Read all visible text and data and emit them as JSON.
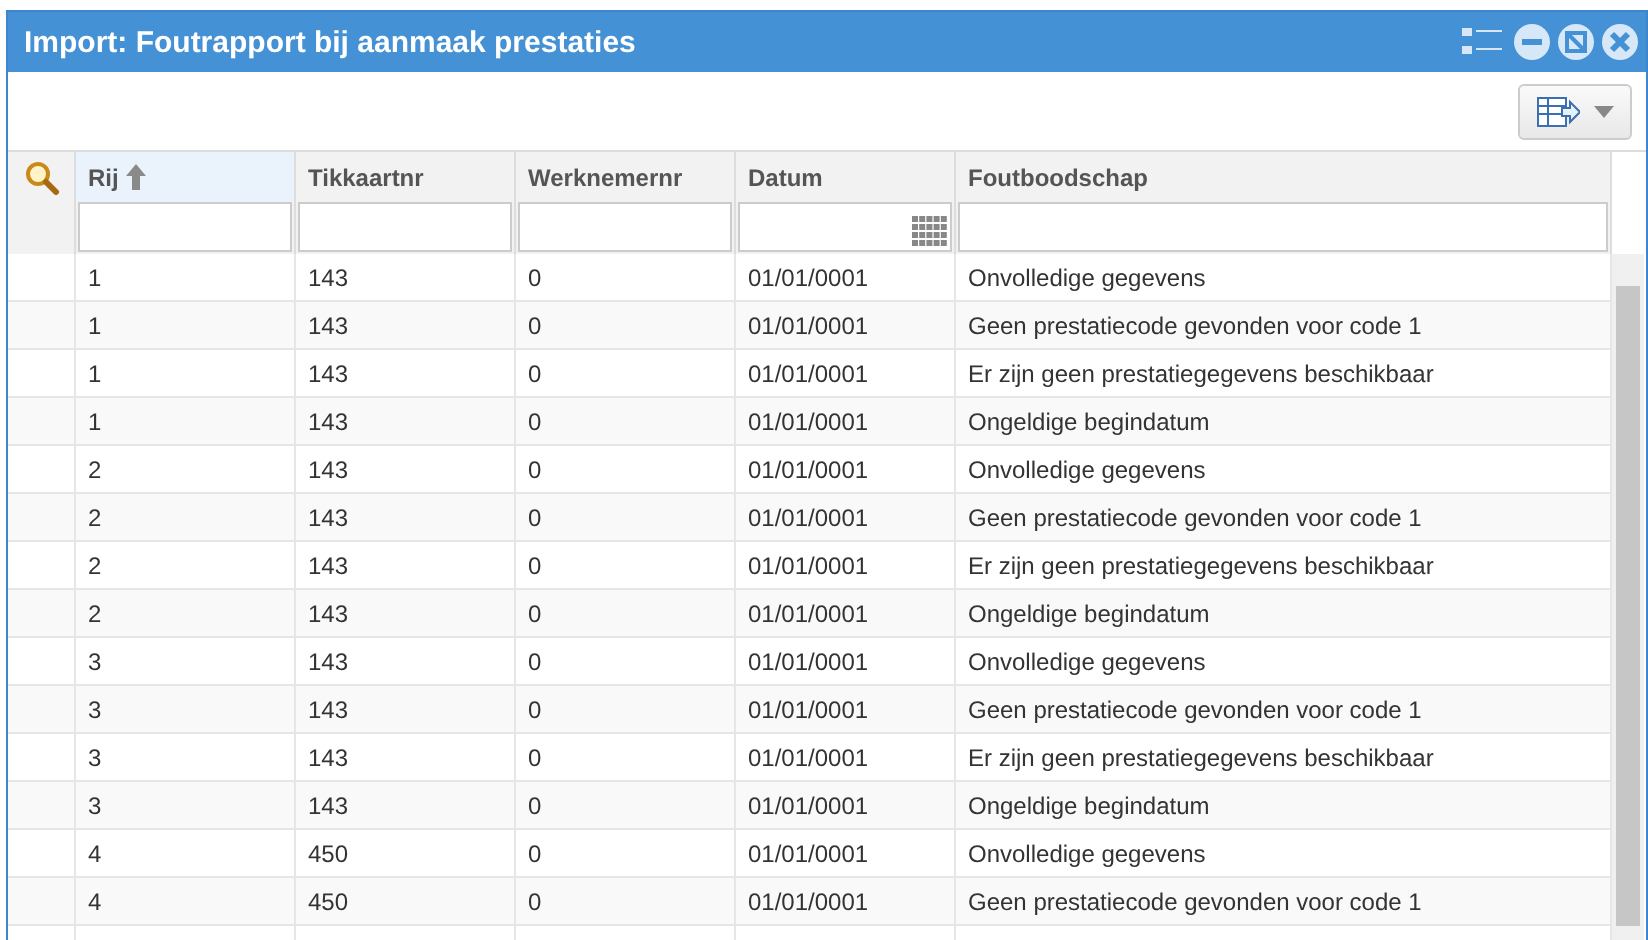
{
  "window": {
    "title": "Import: Foutrapport bij aanmaak prestaties"
  },
  "grid": {
    "columns": [
      {
        "label": "Rij",
        "sorted": true,
        "calendar": false
      },
      {
        "label": "Tikkaartnr",
        "sorted": false,
        "calendar": false
      },
      {
        "label": "Werknemernr",
        "sorted": false,
        "calendar": false
      },
      {
        "label": "Datum",
        "sorted": false,
        "calendar": true
      },
      {
        "label": "Foutboodschap",
        "sorted": false,
        "calendar": false
      }
    ],
    "rows": [
      [
        "1",
        "143",
        "0",
        "01/01/0001",
        "Onvolledige gegevens"
      ],
      [
        "1",
        "143",
        "0",
        "01/01/0001",
        "Geen prestatiecode gevonden voor code 1"
      ],
      [
        "1",
        "143",
        "0",
        "01/01/0001",
        "Er zijn geen prestatiegegevens beschikbaar"
      ],
      [
        "1",
        "143",
        "0",
        "01/01/0001",
        "Ongeldige begindatum"
      ],
      [
        "2",
        "143",
        "0",
        "01/01/0001",
        "Onvolledige gegevens"
      ],
      [
        "2",
        "143",
        "0",
        "01/01/0001",
        "Geen prestatiecode gevonden voor code 1"
      ],
      [
        "2",
        "143",
        "0",
        "01/01/0001",
        "Er zijn geen prestatiegegevens beschikbaar"
      ],
      [
        "2",
        "143",
        "0",
        "01/01/0001",
        "Ongeldige begindatum"
      ],
      [
        "3",
        "143",
        "0",
        "01/01/0001",
        "Onvolledige gegevens"
      ],
      [
        "3",
        "143",
        "0",
        "01/01/0001",
        "Geen prestatiecode gevonden voor code 1"
      ],
      [
        "3",
        "143",
        "0",
        "01/01/0001",
        "Er zijn geen prestatiegegevens beschikbaar"
      ],
      [
        "3",
        "143",
        "0",
        "01/01/0001",
        "Ongeldige begindatum"
      ],
      [
        "4",
        "450",
        "0",
        "01/01/0001",
        "Onvolledige gegevens"
      ],
      [
        "4",
        "450",
        "0",
        "01/01/0001",
        "Geen prestatiecode gevonden voor code 1"
      ]
    ]
  }
}
